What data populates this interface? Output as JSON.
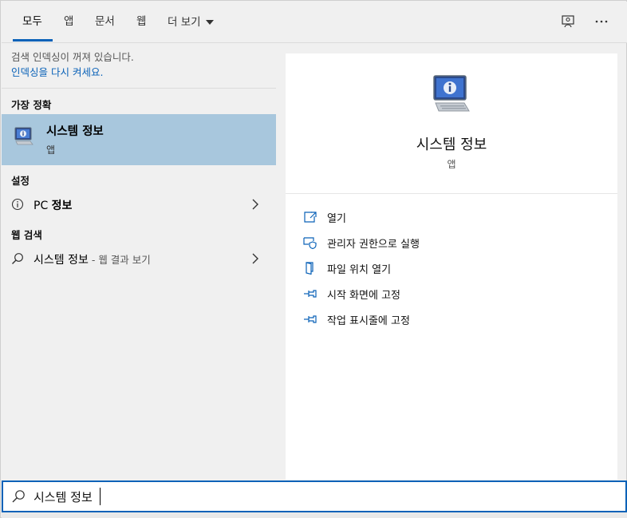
{
  "tabs": [
    {
      "label": "모두",
      "active": true
    },
    {
      "label": "앱"
    },
    {
      "label": "문서"
    },
    {
      "label": "웹"
    },
    {
      "label": "더 보기"
    }
  ],
  "top_icons": [
    "feedback-icon",
    "more-options-icon"
  ],
  "notice": {
    "text": "검색 인덱싱이 꺼져 있습니다.",
    "link": "인덱싱을 다시 켜세요."
  },
  "best_match": {
    "section": "가장 정확",
    "title": "시스템 정보",
    "subtitle": "앱"
  },
  "settings": {
    "section": "설정",
    "item_prefix": "PC",
    "item_bold": "정보"
  },
  "web": {
    "section": "웹 검색",
    "query": "시스템 정보",
    "suffix": " - 웹 결과 보기"
  },
  "detail": {
    "title": "시스템 정보",
    "type": "앱",
    "actions": [
      {
        "label": "열기",
        "icon": "open-icon"
      },
      {
        "label": "관리자 권한으로 실행",
        "icon": "admin-shield-icon"
      },
      {
        "label": "파일 위치 열기",
        "icon": "file-location-icon"
      },
      {
        "label": "시작 화면에 고정",
        "icon": "pin-icon"
      },
      {
        "label": "작업 표시줄에 고정",
        "icon": "pin-icon"
      }
    ]
  },
  "search": {
    "value": "시스템 정보"
  },
  "colors": {
    "accent": "#0a62b8",
    "selected": "#a8c7dd"
  }
}
